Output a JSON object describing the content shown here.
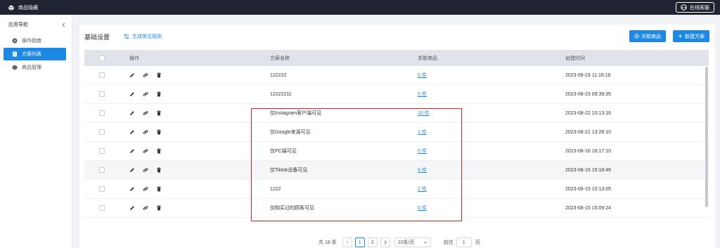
{
  "app": {
    "title": "商品隐藏"
  },
  "topbar": {
    "support_label": "在线客服"
  },
  "sidebar": {
    "nav_title": "应用导航",
    "items": [
      {
        "label": "操作指南",
        "icon": "compass-icon",
        "active": false
      },
      {
        "label": "方案列表",
        "icon": "document-icon",
        "active": true
      },
      {
        "label": "商品管理",
        "icon": "cube-icon",
        "active": false
      }
    ]
  },
  "header": {
    "title": "基础设置",
    "generate_link": "生成常见规则",
    "link_products_button": "关联商品",
    "new_plan_button": "新建方案"
  },
  "table": {
    "columns": {
      "ops": "操作",
      "name": "方案名称",
      "products": "关联商品",
      "created": "创建时间"
    },
    "rows": [
      {
        "name": "122222",
        "products": "0 件",
        "created": "2023-08-23 11:16:16"
      },
      {
        "name": "12222211",
        "products": "0 件",
        "created": "2023-08-23 09:39:35"
      },
      {
        "name": "仅Instagram客户端可见",
        "products": "10 件",
        "created": "2023-08-22 10:13:16"
      },
      {
        "name": "仅Google来源可见",
        "products": "1 件",
        "created": "2023-08-21 13:26:10"
      },
      {
        "name": "仅PC端可见",
        "products": "0 件",
        "created": "2023-08-16 16:17:10"
      },
      {
        "name": "仅Tiktok设备可见",
        "products": "9 件",
        "created": "2023-08-15 15:18:46"
      },
      {
        "name": "1222",
        "products": "2 件",
        "created": "2023-08-15 15:13:05"
      },
      {
        "name": "仅购买过的顾客可见",
        "products": "0 件",
        "created": "2023-08-15 15:09:24"
      }
    ]
  },
  "pagination": {
    "total": "共 18 条",
    "pages": [
      "1",
      "2"
    ],
    "current": "1",
    "page_size": "10条/页",
    "goto_label": "前往",
    "goto_value": "1",
    "pages_label": "页"
  },
  "colors": {
    "accent": "#1e88e5",
    "topbar": "#1f2433",
    "highlight": "#e02020"
  }
}
